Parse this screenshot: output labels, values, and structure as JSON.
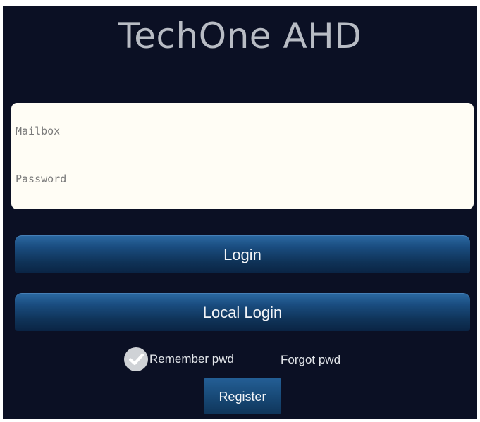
{
  "app": {
    "title": "TechOne AHD"
  },
  "login_form": {
    "mailbox": {
      "placeholder": "Mailbox",
      "value": ""
    },
    "password": {
      "placeholder": "Password",
      "value": ""
    }
  },
  "buttons": {
    "login_label": "Login",
    "local_login_label": "Local Login",
    "register_label": "Register"
  },
  "options": {
    "remember_label": "Remember pwd",
    "remember_checked": true,
    "forgot_label": "Forgot pwd"
  },
  "icons": {
    "remember_checkbox": "check-circle-icon"
  },
  "colors": {
    "background": "#0b1024",
    "card": "#fffdf5",
    "button_top": "#2c6aa3",
    "button_bottom": "#0a2444",
    "title_text": "#b8bcc4"
  }
}
